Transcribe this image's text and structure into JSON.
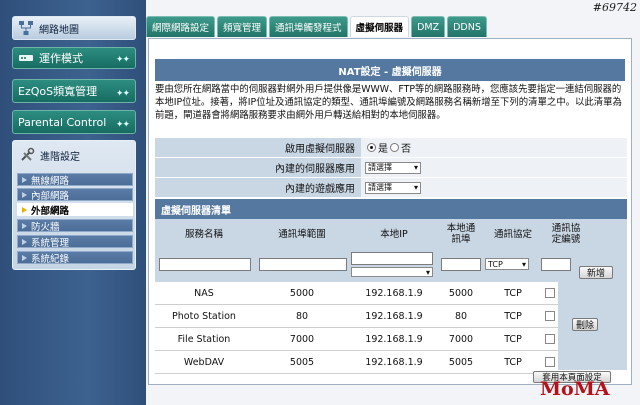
{
  "corner_tag": "#69742",
  "watermark": "MoMA",
  "sidebar": {
    "network_map": "網路地圖",
    "operation_mode": "運作模式",
    "ezqos": "EzQoS頻寬管理",
    "parental": "Parental Control",
    "advanced_title": "進階設定",
    "sub_items": [
      "無線網路",
      "內部網路",
      "外部網路",
      "防火牆",
      "系統管理",
      "系統紀錄"
    ],
    "active_index": 2
  },
  "tabs": [
    "網際網路設定",
    "頻寬管理",
    "通訊埠觸發程式",
    "虛擬伺服器",
    "DMZ",
    "DDNS"
  ],
  "active_tab": 3,
  "panel": {
    "title": "NAT設定 - 虛擬伺服器",
    "description": "要由您所在網路當中的伺服器對網外用戶提供像是WWW、FTP等的網路服務時，您應該先要指定一連結伺服器的本地IP位址。接著，將IP位址及通訊協定的類型、通訊埠編號及網路服務名稱新增至下列的清單之中。以此清單為前題，閘道器會將網路服務要求由網外用戶轉送給相對的本地伺服器。",
    "enable_label": "啟用虛擬伺服器",
    "yes": "是",
    "no": "否",
    "enabled": true,
    "builtin_app_label": "內建的伺服器應用",
    "builtin_game_label": "內建的遊戲應用",
    "select_placeholder": "請選擇",
    "list_title": "虛擬伺服器清單",
    "columns": [
      "服務名稱",
      "通訊埠範圍",
      "本地IP",
      "本地通訊埠",
      "通訊協定",
      "通訊協定編號"
    ],
    "protocol_value": "TCP",
    "add_button": "新增",
    "delete_button": "刪除",
    "apply_button": "套用本頁面設定",
    "rows": [
      {
        "name": "NAS",
        "port": "5000",
        "ip": "192.168.1.9",
        "local_port": "5000",
        "proto": "TCP"
      },
      {
        "name": "Photo Station",
        "port": "80",
        "ip": "192.168.1.9",
        "local_port": "80",
        "proto": "TCP"
      },
      {
        "name": "File Station",
        "port": "7000",
        "ip": "192.168.1.9",
        "local_port": "7000",
        "proto": "TCP"
      },
      {
        "name": "WebDAV",
        "port": "5005",
        "ip": "192.168.1.9",
        "local_port": "5005",
        "proto": "TCP"
      }
    ]
  }
}
